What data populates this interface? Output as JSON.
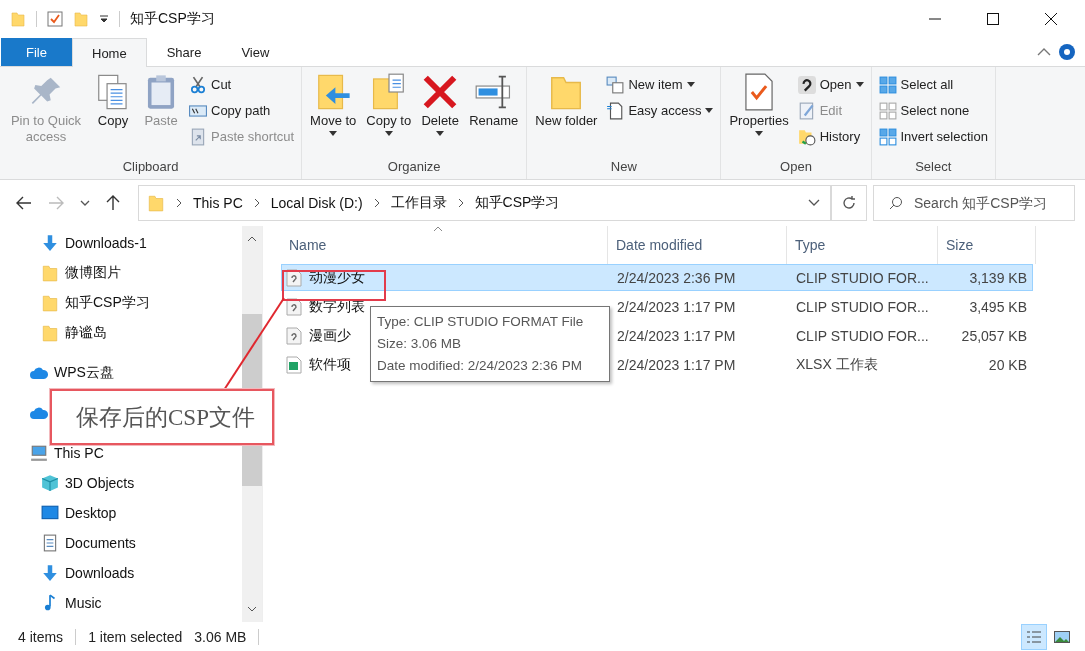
{
  "title_bar": {
    "title": "知乎CSP学习"
  },
  "ribbon_tabs": [
    {
      "label": "File",
      "kind": "file",
      "selected": false
    },
    {
      "label": "Home",
      "kind": "tab",
      "selected": true
    },
    {
      "label": "Share",
      "kind": "tab",
      "selected": false
    },
    {
      "label": "View",
      "kind": "tab",
      "selected": false
    }
  ],
  "ribbon_groups": [
    {
      "name": "Clipboard",
      "items": [
        {
          "kind": "large",
          "label": "Pin to Quick access",
          "disabled": true,
          "dropdown": false
        },
        {
          "kind": "large",
          "label": "Copy",
          "disabled": false,
          "dropdown": false
        },
        {
          "kind": "large",
          "label": "Paste",
          "disabled": true,
          "dropdown": false
        },
        {
          "kind": "small",
          "label": "Cut",
          "disabled": false,
          "dropdown": false
        },
        {
          "kind": "small",
          "label": "Copy path",
          "disabled": false,
          "dropdown": false
        },
        {
          "kind": "small",
          "label": "Paste shortcut",
          "disabled": true,
          "dropdown": false
        }
      ]
    },
    {
      "name": "Organize",
      "items": [
        {
          "kind": "large",
          "label": "Move to",
          "disabled": false,
          "dropdown": true
        },
        {
          "kind": "large",
          "label": "Copy to",
          "disabled": false,
          "dropdown": true
        },
        {
          "kind": "large",
          "label": "Delete",
          "disabled": false,
          "dropdown": true
        },
        {
          "kind": "large",
          "label": "Rename",
          "disabled": false,
          "dropdown": false
        }
      ]
    },
    {
      "name": "New",
      "items": [
        {
          "kind": "large",
          "label": "New folder",
          "disabled": false,
          "dropdown": false
        },
        {
          "kind": "small",
          "label": "New item",
          "disabled": false,
          "dropdown": true
        },
        {
          "kind": "small",
          "label": "Easy access",
          "disabled": false,
          "dropdown": true
        }
      ]
    },
    {
      "name": "Open",
      "items": [
        {
          "kind": "large",
          "label": "Properties",
          "disabled": false,
          "dropdown": true
        },
        {
          "kind": "small",
          "label": "Open",
          "disabled": false,
          "dropdown": true
        },
        {
          "kind": "small",
          "label": "Edit",
          "disabled": true,
          "dropdown": false
        },
        {
          "kind": "small",
          "label": "History",
          "disabled": false,
          "dropdown": false
        }
      ]
    },
    {
      "name": "Select",
      "items": [
        {
          "kind": "small",
          "label": "Select all",
          "disabled": false,
          "dropdown": false
        },
        {
          "kind": "small",
          "label": "Select none",
          "disabled": false,
          "dropdown": false
        },
        {
          "kind": "small",
          "label": "Invert selection",
          "disabled": false,
          "dropdown": false
        }
      ]
    }
  ],
  "address_bar": {
    "crumbs": [
      "This PC",
      "Local Disk (D:)",
      "工作目录",
      "知乎CSP学习"
    ]
  },
  "search": {
    "placeholder": "Search 知乎CSP学习"
  },
  "sidebar": {
    "quick_access_items": [
      {
        "label": "Downloads-1"
      },
      {
        "label": "微博图片"
      },
      {
        "label": "知乎CSP学习"
      },
      {
        "label": "静谧岛"
      }
    ],
    "items": [
      {
        "label": "WPS云盘",
        "kind": "cloud"
      },
      {
        "kind": "cloud"
      },
      {
        "label": "This PC",
        "kind": "pc",
        "children": [
          {
            "label": "3D Objects"
          },
          {
            "label": "Desktop"
          },
          {
            "label": "Documents"
          },
          {
            "label": "Downloads"
          },
          {
            "label": "Music"
          }
        ]
      }
    ]
  },
  "table": {
    "columns": [
      "Name",
      "Date modified",
      "Type",
      "Size"
    ],
    "rows": [
      {
        "name": "动漫少女",
        "date": "2/24/2023 2:36 PM",
        "type": "CLIP STUDIO FOR...",
        "size": "3,139 KB",
        "kind": "csp",
        "selected": true
      },
      {
        "name": "数字列表",
        "date": "2/24/2023 1:17 PM",
        "type": "CLIP STUDIO FOR...",
        "size": "3,495 KB",
        "kind": "csp",
        "selected": false
      },
      {
        "name": "漫画少",
        "date": "2/24/2023 1:17 PM",
        "type": "CLIP STUDIO FOR...",
        "size": "25,057 KB",
        "kind": "csp",
        "selected": false
      },
      {
        "name": "软件项",
        "date": "2/24/2023 1:17 PM",
        "type": "XLSX 工作表",
        "size": "20 KB",
        "kind": "xlsx",
        "selected": false
      }
    ]
  },
  "tooltip": {
    "lines": [
      "Type: CLIP STUDIO FORMAT File",
      "Size: 3.06 MB",
      "Date modified: 2/24/2023 2:36 PM"
    ]
  },
  "annotation": {
    "text": "保存后的CSP文件"
  },
  "status_bar": {
    "item_count": "4 items",
    "selection": "1 item selected",
    "selection_size": "3.06 MB"
  },
  "view_buttons": [
    {
      "kind": "details",
      "selected": true
    },
    {
      "kind": "large-icons",
      "selected": false
    }
  ]
}
